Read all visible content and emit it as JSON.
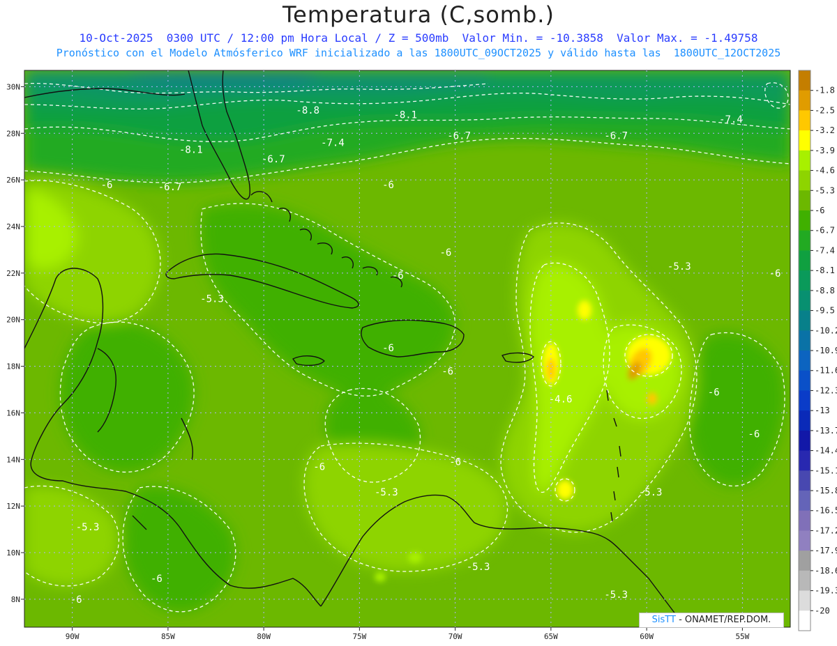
{
  "title": "Temperatura (C,somb.)",
  "subtitle1": "10-Oct-2025  0300 UTC / 12:00 pm Hora Local / Z = 500mb  Valor Min. = -10.3858  Valor Max. = -1.49758",
  "subtitle2": "Pronóstico con el Modelo Atmósferico WRF inicializado a las 1800UTC_09OCT2025 y válido hasta las  1800UTC_12OCT2025",
  "credit": {
    "brand": "SisTT",
    "text": " - ONAMET/REP.DOM."
  },
  "axes": {
    "lat_labels": [
      "8N",
      "10N",
      "12N",
      "14N",
      "16N",
      "18N",
      "20N",
      "22N",
      "24N",
      "26N",
      "28N",
      "30N"
    ],
    "lat_values": [
      8,
      10,
      12,
      14,
      16,
      18,
      20,
      22,
      24,
      26,
      28,
      30
    ],
    "lon_labels": [
      "90W",
      "85W",
      "80W",
      "75W",
      "70W",
      "65W",
      "60W",
      "55W"
    ],
    "lon_values": [
      -90,
      -85,
      -80,
      -75,
      -70,
      -65,
      -60,
      -55
    ],
    "lon_range": [
      -92.5,
      -52.5
    ],
    "lat_range": [
      6.8,
      30.7
    ]
  },
  "colorbar": {
    "levels": [
      "-1.8",
      "-2.5",
      "-3.2",
      "-3.9",
      "-4.6",
      "-5.3",
      "-6",
      "-6.7",
      "-7.4",
      "-8.1",
      "-8.8",
      "-9.5",
      "-10.2",
      "-10.9",
      "-11.6",
      "-12.3",
      "-13",
      "-13.7",
      "-14.4",
      "-15.1",
      "-15.8",
      "-16.5",
      "-17.2",
      "-17.9",
      "-18.6",
      "-19.3",
      "-20"
    ],
    "colors": [
      "#c47e00",
      "#e09c00",
      "#ffc800",
      "#ffff00",
      "#a8f000",
      "#8ed400",
      "#6cb800",
      "#40b000",
      "#22aa22",
      "#10a040",
      "#0a9a5a",
      "#089070",
      "#08808a",
      "#0a72a6",
      "#0c64c0",
      "#0a50c8",
      "#0a3cc8",
      "#0a2ab8",
      "#1218a8",
      "#2828b0",
      "#4848b0",
      "#6464b8",
      "#8070b8",
      "#9080c0",
      "#a0a0a0",
      "#b8b8b8",
      "#dcdcdc",
      "#ffffff"
    ]
  },
  "contour_labels": [
    {
      "text": "-8.8",
      "lon": -77.7,
      "lat": 29.0
    },
    {
      "text": "-8.1",
      "lon": -72.6,
      "lat": 28.8
    },
    {
      "text": "-7.4",
      "lon": -55.6,
      "lat": 28.6
    },
    {
      "text": "-8.1",
      "lon": -83.8,
      "lat": 27.3
    },
    {
      "text": "-7.4",
      "lon": -76.4,
      "lat": 27.6
    },
    {
      "text": "-6.7",
      "lon": -69.8,
      "lat": 27.9
    },
    {
      "text": "-6.7",
      "lon": -61.6,
      "lat": 27.9
    },
    {
      "text": "-6.7",
      "lon": -79.5,
      "lat": 26.9
    },
    {
      "text": "-6",
      "lon": -88.2,
      "lat": 25.8
    },
    {
      "text": "-6.7",
      "lon": -84.9,
      "lat": 25.7
    },
    {
      "text": "-6",
      "lon": -73.5,
      "lat": 25.8
    },
    {
      "text": "-6",
      "lon": -70.5,
      "lat": 22.9
    },
    {
      "text": "-5.3",
      "lon": -58.3,
      "lat": 22.3
    },
    {
      "text": "-6",
      "lon": -53.3,
      "lat": 22.0
    },
    {
      "text": "-6",
      "lon": -73.0,
      "lat": 21.9
    },
    {
      "text": "-5.3",
      "lon": -82.7,
      "lat": 20.9
    },
    {
      "text": "-6",
      "lon": -73.5,
      "lat": 18.8
    },
    {
      "text": "-6",
      "lon": -70.4,
      "lat": 17.8
    },
    {
      "text": "-6",
      "lon": -56.5,
      "lat": 16.9
    },
    {
      "text": "-4.6",
      "lon": -64.5,
      "lat": 16.6
    },
    {
      "text": "-6",
      "lon": -54.4,
      "lat": 15.1
    },
    {
      "text": "-6",
      "lon": -70.0,
      "lat": 13.9
    },
    {
      "text": "-6",
      "lon": -77.1,
      "lat": 13.7
    },
    {
      "text": "-5.3",
      "lon": -59.8,
      "lat": 12.6
    },
    {
      "text": "-5.3",
      "lon": -73.6,
      "lat": 12.6
    },
    {
      "text": "-5.3",
      "lon": -89.2,
      "lat": 11.1
    },
    {
      "text": "-5.3",
      "lon": -68.8,
      "lat": 9.4
    },
    {
      "text": "-6",
      "lon": -85.6,
      "lat": 8.9
    },
    {
      "text": "-6",
      "lon": -89.8,
      "lat": 8.0
    },
    {
      "text": "-5.3",
      "lon": -61.6,
      "lat": 8.2
    }
  ]
}
